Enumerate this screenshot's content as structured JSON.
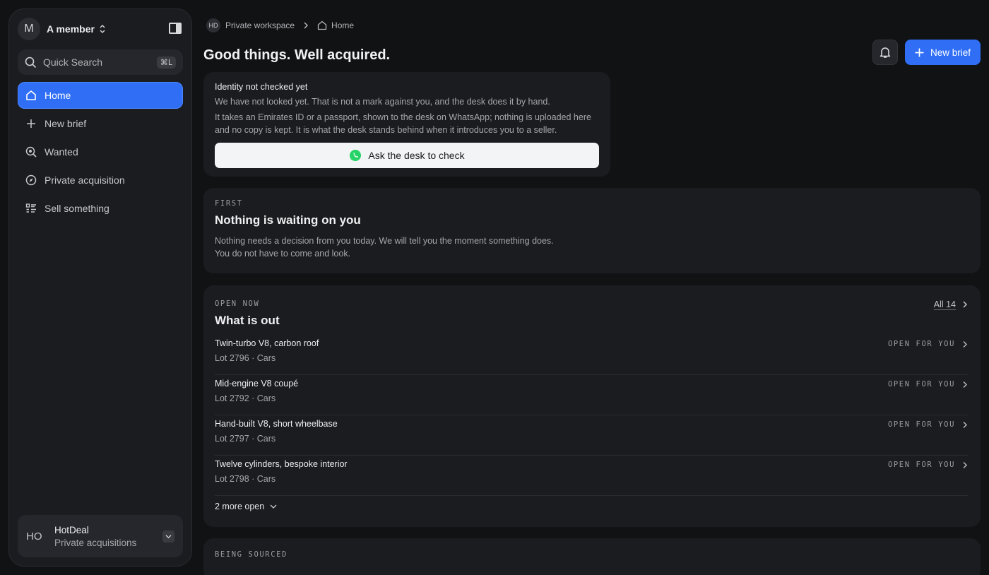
{
  "sidebar": {
    "member": {
      "initial": "M",
      "name": "A member"
    },
    "search": {
      "label": "Quick Search",
      "shortcut": "⌘L"
    },
    "nav": [
      {
        "label": "Home",
        "icon": "home-icon",
        "active": true
      },
      {
        "label": "New brief",
        "icon": "plus-icon"
      },
      {
        "label": "Wanted",
        "icon": "search-zoom-icon"
      },
      {
        "label": "Private acquisition",
        "icon": "compass-icon"
      },
      {
        "label": "Sell something",
        "icon": "list-icon"
      }
    ],
    "org": {
      "initials": "HO",
      "name": "HotDeal",
      "subtitle": "Private acquisitions"
    }
  },
  "breadcrumb": {
    "workspace_badge": "HD",
    "workspace": "Private workspace",
    "page": "Home"
  },
  "header": {
    "title": "Good things. Well acquired.",
    "new_brief": "New brief"
  },
  "identity": {
    "title": "Identity not checked yet",
    "line1": "We have not looked yet. That is not a mark against you, and the desk does it by hand.",
    "line2": "It takes an Emirates ID or a passport, shown to the desk on WhatsApp; nothing is uploaded here and no copy is kept. It is what the desk stands behind when it introduces you to a seller.",
    "button": "Ask the desk to check"
  },
  "first": {
    "eyebrow": "FIRST",
    "title": "Nothing is waiting on you",
    "desc": "Nothing needs a decision from you today. We will tell you the moment something does. You do not have to come and look."
  },
  "open_now": {
    "eyebrow": "OPEN NOW",
    "title": "What is out",
    "all_link": "All 14",
    "lots": [
      {
        "name": "Twin-turbo V8, carbon roof",
        "meta": "Lot 2796 · Cars",
        "status": "OPEN FOR YOU"
      },
      {
        "name": "Mid-engine V8 coupé",
        "meta": "Lot 2792 · Cars",
        "status": "OPEN FOR YOU"
      },
      {
        "name": "Hand-built V8, short wheelbase",
        "meta": "Lot 2797 · Cars",
        "status": "OPEN FOR YOU"
      },
      {
        "name": "Twelve cylinders, bespoke interior",
        "meta": "Lot 2798 · Cars",
        "status": "OPEN FOR YOU"
      }
    ],
    "more": "2 more open"
  },
  "being_sourced": {
    "eyebrow": "BEING SOURCED"
  },
  "colors": {
    "accent": "#2f6ef5",
    "whatsapp": "#25d366",
    "background": "#111214",
    "card": "#1b1c20"
  }
}
